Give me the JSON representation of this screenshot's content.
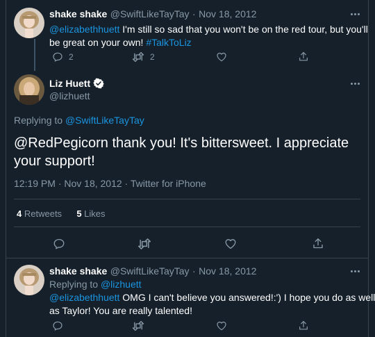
{
  "tweet1": {
    "display_name": "shake shake",
    "handle": "@SwiftLikeTayTay",
    "dot": "·",
    "date": "Nov 18, 2012",
    "mention": "@elizabethhuett",
    "text_line1_rest": " I'm still so sad that you won't be on the red tour, but you'll",
    "text_line2": "be great on your own! ",
    "hashtag": "#TalkToLiz",
    "replies": "2",
    "retweets": "2"
  },
  "main_tweet": {
    "display_name": "Liz Huett",
    "handle": "@lizhuett",
    "replying_label": "Replying to ",
    "replying_to": "@SwiftLikeTayTay",
    "text_line1": "@RedPegicorn thank you! It's bittersweet. I appreciate",
    "text_line2": "your support!",
    "meta": "12:19 PM · Nov 18, 2012 · Twitter for iPhone",
    "retweets_count": "4",
    "retweets_label": "Retweets",
    "likes_count": "5",
    "likes_label": "Likes"
  },
  "tweet3": {
    "display_name": "shake shake",
    "handle": "@SwiftLikeTayTay",
    "dot": "·",
    "date": "Nov 18, 2012",
    "replying_label": "Replying to ",
    "replying_to": "@lizhuett",
    "mention": "@elizabethhuett",
    "text_line1_rest": " OMG I can't believe you answered!:') I hope you do as well",
    "text_line2": "as Taylor! You are really talented!"
  },
  "colors": {
    "background": "#15202b",
    "link": "#1b95e0",
    "secondary_text": "#8899a6",
    "border": "#38444d"
  },
  "icons": [
    "reply-icon",
    "retweet-icon",
    "like-icon",
    "share-icon",
    "more-icon",
    "verified-badge-icon"
  ]
}
